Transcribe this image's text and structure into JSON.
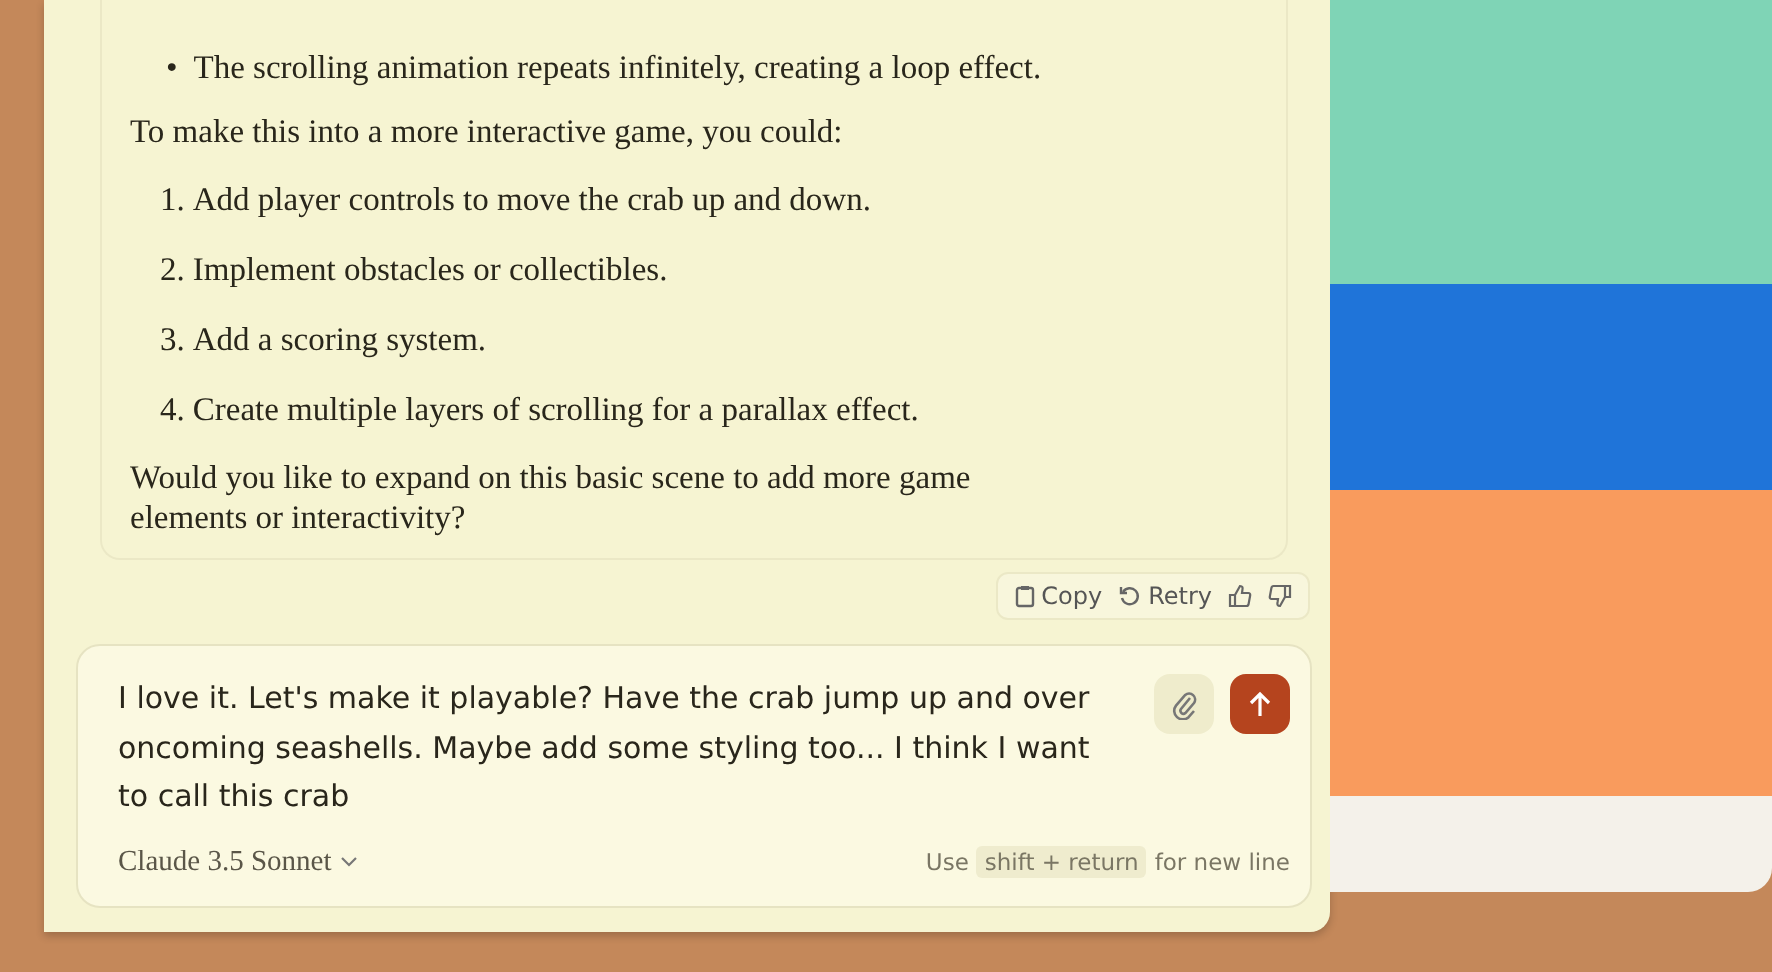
{
  "message": {
    "bullets": [
      {
        "marker": "•",
        "text": "The scrolling animation repeats infinitely, creating a loop effect."
      }
    ],
    "intro": "To make this into a more interactive game, you could:",
    "steps": [
      {
        "number": "1.",
        "text": "Add player controls to move the crab up and down."
      },
      {
        "number": "2.",
        "text": "Implement obstacles or collectibles."
      },
      {
        "number": "3.",
        "text": "Add a scoring system."
      },
      {
        "number": "4.",
        "text": "Create multiple layers of scrolling for a parallax effect."
      }
    ],
    "closing": "Would you like to expand on this basic scene to add more game elements or interactivity?",
    "actions": [
      {
        "kind": "copy",
        "label": "Copy"
      },
      {
        "kind": "retry",
        "label": "Retry"
      },
      {
        "kind": "thumbs-up"
      },
      {
        "kind": "thumbs-down"
      }
    ]
  },
  "composer": {
    "value": "I love it. Let's make it playable? Have the crab jump up and over oncoming seashells. Maybe add some styling too... I think I want to call this crab",
    "model": "Claude 3.5 Sonnet",
    "hint": "Use",
    "shortcut": "shift + return",
    "hint_end": "for new line"
  },
  "preview": {
    "bands": [
      {
        "color": "#7fd4b6"
      },
      {
        "color": "#1f74d9"
      },
      {
        "color": "#f99b5d"
      }
    ]
  }
}
